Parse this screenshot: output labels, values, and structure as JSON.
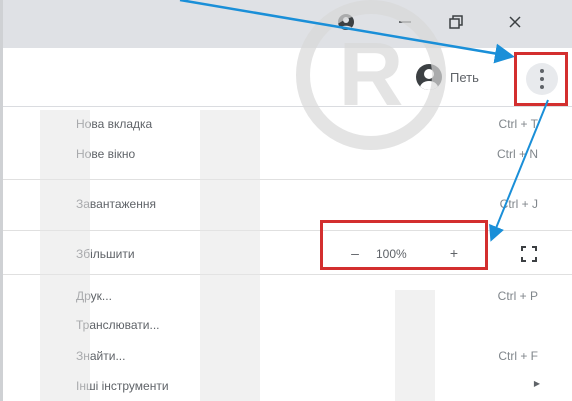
{
  "window": {
    "profile_name": "Петь",
    "icons": [
      "profile-icon",
      "minimize-icon",
      "restore-icon",
      "close-icon",
      "more-vert-icon"
    ]
  },
  "menu": {
    "new_tab": {
      "label": "Нова вкладка",
      "shortcut": "Ctrl + T"
    },
    "new_window": {
      "label": "Нове вікно",
      "shortcut": "Ctrl + N"
    },
    "downloads": {
      "label": "Завантаження",
      "shortcut": "Ctrl + J"
    },
    "zoom": {
      "label": "Збільшити",
      "minus": "–",
      "value": "100%",
      "plus": "+"
    },
    "print": {
      "label": "Друк...",
      "shortcut": "Ctrl + P"
    },
    "cast": {
      "label": "Транслювати..."
    },
    "find": {
      "label": "Знайти...",
      "shortcut": "Ctrl + F"
    },
    "more_tools": {
      "label": "Інші інструменти"
    }
  },
  "colors": {
    "highlight": "#d32f2f",
    "arrow": "#1a8fd8"
  }
}
